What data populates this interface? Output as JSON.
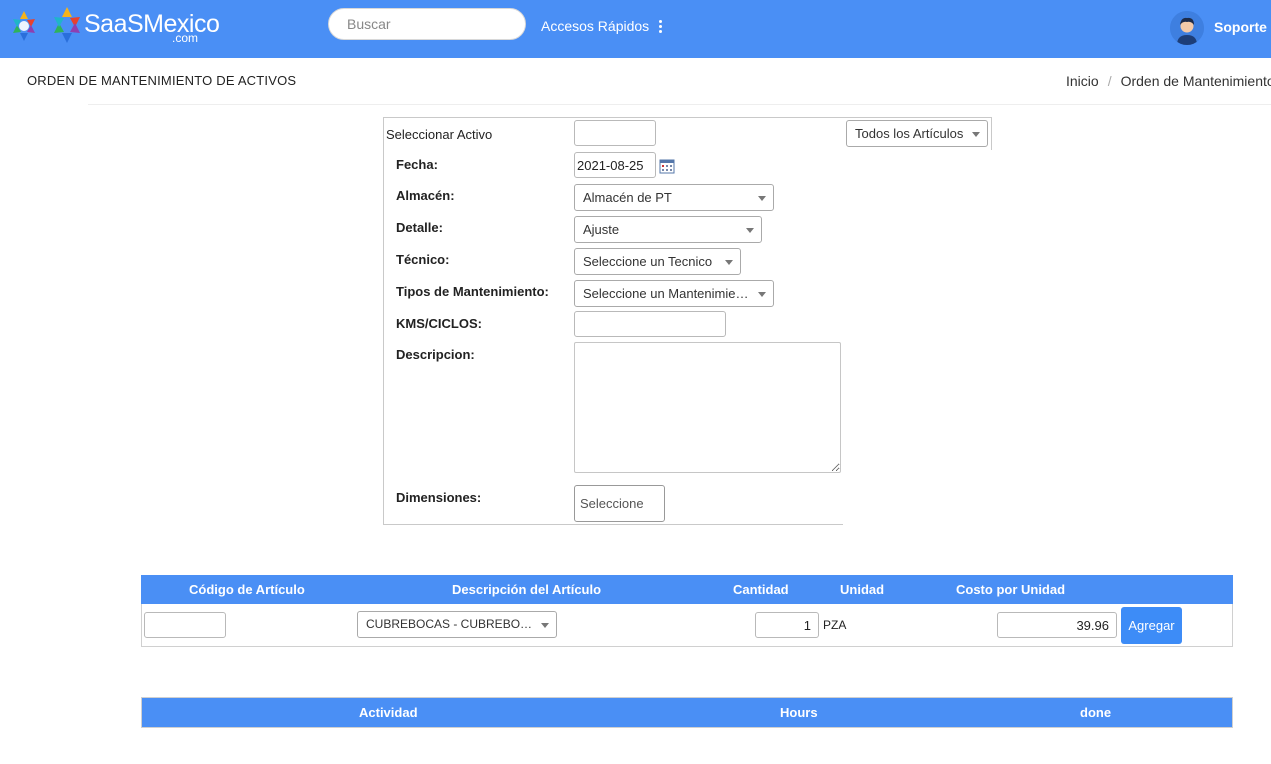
{
  "header": {
    "logo_text": "SaaSMexico",
    "logo_sub": ".com",
    "search_placeholder": "Buscar",
    "quick_access": "Accesos Rápidos",
    "user_name": "Soporte"
  },
  "page": {
    "title": "ORDEN DE MANTENIMIENTO DE ACTIVOS",
    "breadcrumb": [
      "Inicio",
      "Orden de Mantenimiento"
    ]
  },
  "form": {
    "select_asset_label": "Seleccionar Activo",
    "select_asset_value": "",
    "articles_filter": "Todos los Artículos",
    "date_label": "Fecha:",
    "date_value": "2021-08-25",
    "warehouse_label": "Almacén:",
    "warehouse_value": "Almacén de PT",
    "detail_label": "Detalle:",
    "detail_value": "Ajuste",
    "technician_label": "Técnico:",
    "technician_value": "Seleccione un Tecnico",
    "maint_type_label": "Tipos de Mantenimiento:",
    "maint_type_value": "Seleccione un Mantenimiento",
    "kms_label": "KMS/CICLOS:",
    "kms_value": "",
    "description_label": "Descripcion:",
    "description_value": "",
    "dimensions_label": "Dimensiones:",
    "dimensions_button": "Seleccione"
  },
  "items_table": {
    "headers": [
      "Código de Artículo",
      "Descripción del Artículo",
      "Cantidad",
      "Unidad",
      "Costo por Unidad"
    ],
    "row": {
      "code": "",
      "description": "CUBREBOCAS - CUBREBOCAS",
      "quantity": "1",
      "unit": "PZA",
      "unit_cost": "39.96"
    },
    "add_button": "Agregar"
  },
  "activities_table": {
    "headers": [
      "Actividad",
      "Hours",
      "done"
    ]
  },
  "colors": {
    "primary": "#4a8ff5",
    "button": "#3d8cf7"
  }
}
